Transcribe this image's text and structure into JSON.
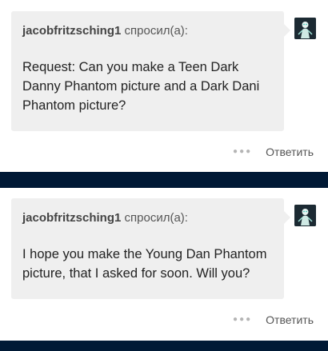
{
  "posts": [
    {
      "asker_name": "jacobfritzsching1",
      "asked_label": "спросил(а):",
      "question": "Request: Can you make a Teen Dark Danny Phantom picture and a Dark Dani Phantom picture?",
      "more_icon": "more-dots",
      "reply_label": "Ответить"
    },
    {
      "asker_name": "jacobfritzsching1",
      "asked_label": "спросил(а):",
      "question": "I hope you make the Young Dan Phantom picture, that I asked for soon. Will you?",
      "more_icon": "more-dots",
      "reply_label": "Ответить"
    }
  ],
  "colors": {
    "background": "#ffffff",
    "bubble": "#efefef",
    "divider": "#001935",
    "avatar": "#1c2a33"
  }
}
